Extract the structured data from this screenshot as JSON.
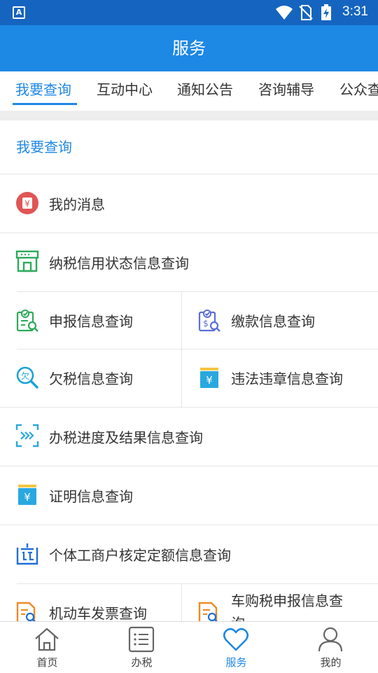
{
  "status_bar": {
    "time": "3:31",
    "app_badge": "A",
    "icons": [
      "wifi-icon",
      "no-sim-icon",
      "battery-charging-icon"
    ]
  },
  "header": {
    "title": "服务"
  },
  "tabs": [
    {
      "label": "我要查询",
      "active": true
    },
    {
      "label": "互动中心",
      "active": false
    },
    {
      "label": "通知公告",
      "active": false
    },
    {
      "label": "咨询辅导",
      "active": false
    },
    {
      "label": "公众查",
      "active": false
    }
  ],
  "section": {
    "title": "我要查询",
    "items": {
      "messages": {
        "label": "我的消息",
        "icon": "yuan-badge-icon"
      },
      "credit_status": {
        "label": "纳税信用状态信息查询",
        "icon": "storefront-icon"
      },
      "declaration": {
        "label": "申报信息查询",
        "icon": "clipboard-search-icon"
      },
      "payment": {
        "label": "缴款信息查询",
        "icon": "payment-search-icon"
      },
      "arrears": {
        "label": "欠税信息查询",
        "icon": "arrears-search-icon"
      },
      "violation": {
        "label": "违法违章信息查询",
        "icon": "yuan-card-icon"
      },
      "progress": {
        "label": "办税进度及结果信息查询",
        "icon": "progress-chevrons-icon"
      },
      "certificate": {
        "label": "证明信息查询",
        "icon": "yuan-certificate-icon"
      },
      "quota": {
        "label": "个体工商户核定定额信息查询",
        "icon": "quota-icon"
      },
      "vehicle_invoice": {
        "label": "机动车发票查询",
        "icon": "document-search-icon"
      },
      "purchase_tax": {
        "label": "车购税申报信息查",
        "label_line2": "询",
        "icon": "document-search-icon"
      }
    }
  },
  "bottom_nav": [
    {
      "label": "首页",
      "icon": "home-icon",
      "active": false
    },
    {
      "label": "办税",
      "icon": "list-icon",
      "active": false
    },
    {
      "label": "服务",
      "icon": "heart-icon",
      "active": true
    },
    {
      "label": "我的",
      "icon": "user-icon",
      "active": false
    }
  ],
  "colors": {
    "status_bar": "#1565c0",
    "header": "#1e88e5",
    "accent": "#1e88e5",
    "green_icon": "#2eaa5a",
    "orange_icon": "#f08a24",
    "red_icon": "#e05555"
  }
}
